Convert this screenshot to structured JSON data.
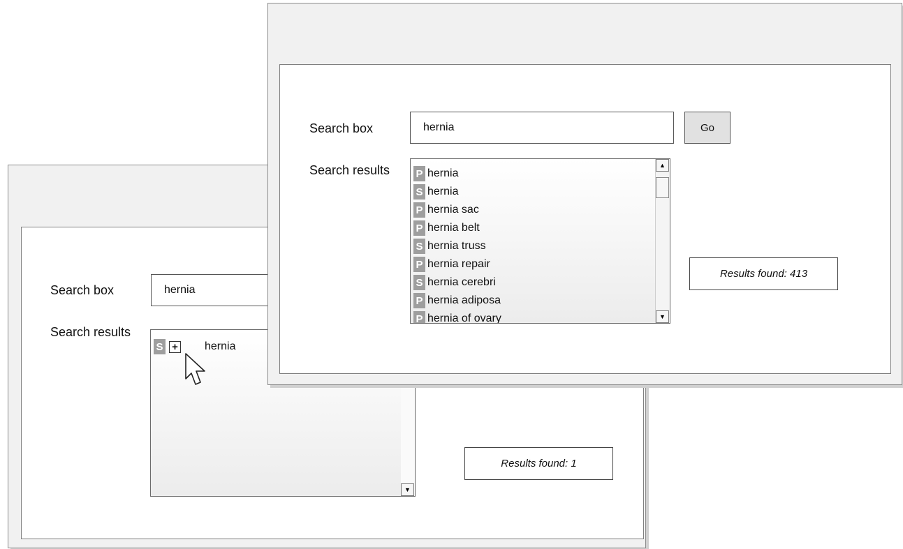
{
  "back_window": {
    "search_label": "Search box",
    "search_value": "hernia",
    "results_label": "Search results",
    "result_item": {
      "tag": "S",
      "expand": "+",
      "text": "hernia"
    },
    "scroll_down": "▼",
    "results_found": "Results found: 1"
  },
  "front_window": {
    "search_label": "Search box",
    "search_value": "hernia",
    "go_label": "Go",
    "results_label": "Search results",
    "results": [
      {
        "tag": "P",
        "text": "hernia"
      },
      {
        "tag": "S",
        "text": "hernia"
      },
      {
        "tag": "P",
        "text": "hernia sac"
      },
      {
        "tag": "P",
        "text": "hernia belt"
      },
      {
        "tag": "S",
        "text": "hernia truss"
      },
      {
        "tag": "P",
        "text": "hernia repair"
      },
      {
        "tag": "S",
        "text": "hernia cerebri"
      },
      {
        "tag": "P",
        "text": "hernia adiposa"
      },
      {
        "tag": "P",
        "text": "hernia of ovary"
      }
    ],
    "scroll_up": "▲",
    "scroll_down": "▼",
    "results_found": "Results found: 413"
  }
}
